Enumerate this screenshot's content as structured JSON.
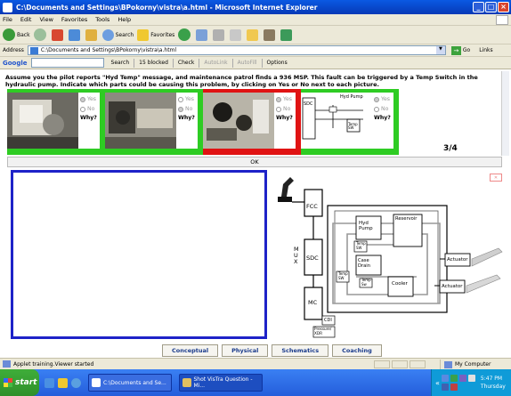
{
  "window": {
    "title": "C:\\Documents and Settings\\BPokorny\\vistra\\a.html - Microsoft Internet Explorer",
    "menu": [
      "File",
      "Edit",
      "View",
      "Favorites",
      "Tools",
      "Help"
    ]
  },
  "toolbar": {
    "back": "Back",
    "search": "Search",
    "favorites": "Favorites"
  },
  "address": {
    "label": "Address",
    "value": "C:\\Documents and Settings\\BPokorny\\vistra\\a.html",
    "go": "Go",
    "links": "Links"
  },
  "google": {
    "logo": "Google",
    "search": "Search",
    "blocked": "15 blocked",
    "check": "Check",
    "autolink": "AutoLink",
    "autofill": "AutoFill",
    "options": "Options"
  },
  "question": "Assume you the pilot reports \"Hyd Temp\" message, and maintenance patrol finds a 936 MSP. This fault can be triggered by a Temp Switch in the hydraulic pump. Indicate which parts could be causing this problem, by clicking on Yes or No next to each picture.",
  "choices": [
    {
      "yes": "Yes",
      "no": "No",
      "why": "Why?",
      "color": "#2ecc23"
    },
    {
      "yes": "Yes",
      "no": "No",
      "why": "Why?",
      "color": "#2ecc23"
    },
    {
      "yes": "Yes",
      "no": "No",
      "why": "Why?",
      "color": "#e01313"
    },
    {
      "yes": "Yes",
      "no": "No",
      "why": "Why?",
      "color": "#2ecc23"
    }
  ],
  "schematic_labels": {
    "sdc": "SDC",
    "hyd_pump": "Hyd Pump",
    "temp_sw": "Temp SW"
  },
  "counter": "3/4",
  "ok": "OK",
  "diagram": {
    "fcc": "FCC",
    "sdc": "SDC",
    "mc": "MC",
    "mux": [
      "M",
      "U",
      "X"
    ],
    "hyd_pump": [
      "Hyd",
      "Pump"
    ],
    "reservoir": "Reservoir",
    "case_drain": [
      "Case",
      "Drain"
    ],
    "cooler": "Cooler",
    "actuator1": "Actuator",
    "actuator2": "Actuator",
    "temp_sw": [
      "Temp",
      "SW"
    ],
    "temp_sw2": [
      "Temp",
      "Sw"
    ],
    "temp_sw3": [
      "Temp",
      "SW"
    ],
    "cdi": "CDI",
    "pressure": "Pressure/ XDR"
  },
  "tabs": [
    "Conceptual",
    "Physical",
    "Schematics",
    "Coaching"
  ],
  "status": {
    "text": "Applet training.Viewer started",
    "zone": "My Computer"
  },
  "taskbar": {
    "start": "start",
    "tasks": [
      "C:\\Documents and Se...",
      "Shot VisTra Question - Mi..."
    ],
    "time": "5:47 PM",
    "day": "Thursday"
  }
}
